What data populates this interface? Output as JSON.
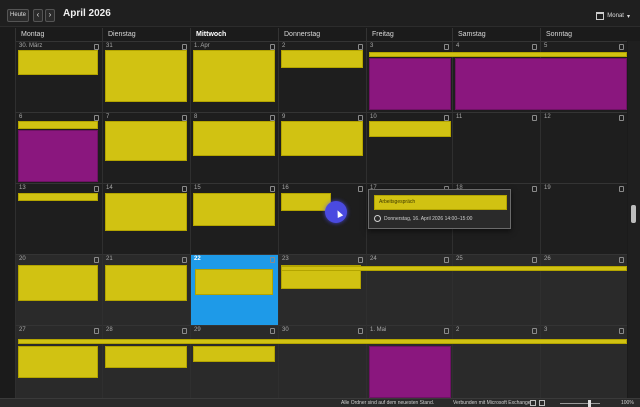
{
  "toolbar": {
    "today_label": "Heute",
    "prev_icon": "chevron-left-icon",
    "next_icon": "chevron-right-icon",
    "month_title": "April 2026",
    "view_label": "Monat",
    "view_icon": "calendar-icon"
  },
  "days": [
    {
      "label": "Montag",
      "today": false
    },
    {
      "label": "Dienstag",
      "today": false
    },
    {
      "label": "Mittwoch",
      "today": true
    },
    {
      "label": "Donnerstag",
      "today": false
    },
    {
      "label": "Freitag",
      "today": false
    },
    {
      "label": "Samstag",
      "today": false
    },
    {
      "label": "Sonntag",
      "today": false
    }
  ],
  "weeks": [
    {
      "dates": [
        "30. März",
        "31",
        "1. Apr",
        "2",
        "3",
        "4",
        "5"
      ]
    },
    {
      "dates": [
        "6",
        "7",
        "8",
        "9",
        "10",
        "11",
        "12"
      ]
    },
    {
      "dates": [
        "13",
        "14",
        "15",
        "16",
        "17",
        "18",
        "19"
      ]
    },
    {
      "dates": [
        "20",
        "21",
        "22",
        "23",
        "24",
        "25",
        "26"
      ]
    },
    {
      "dates": [
        "27",
        "28",
        "29",
        "30",
        "1. Mai",
        "2",
        "3"
      ]
    }
  ],
  "today_date": "22",
  "popup": {
    "title": "Arbeitsgespräch",
    "meta": "Donnerstag, 16. April 2026 14:00–15:00"
  },
  "status": {
    "left": "Alle Ordner sind auf dem neuesten Stand.",
    "right": "Verbunden mit Microsoft Exchange",
    "zoom": "100%"
  },
  "colors": {
    "event_yellow": "#d1c212",
    "event_purple": "#8a177e",
    "today_blue": "#1e9ae8"
  }
}
